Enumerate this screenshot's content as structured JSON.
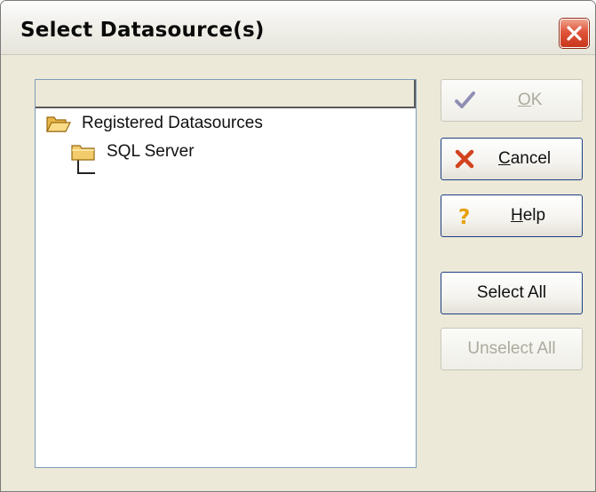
{
  "window": {
    "title": "Select Datasource(s)",
    "close_icon": "close-icon"
  },
  "tree": {
    "header": "",
    "nodes": [
      {
        "label": "Registered Datasources",
        "icon": "folder-open-icon",
        "level": 0
      },
      {
        "label": "SQL Server",
        "icon": "folder-icon",
        "level": 1
      }
    ]
  },
  "buttons": {
    "ok": {
      "mnemonic": "O",
      "rest": "K",
      "enabled": false,
      "icon": "checkmark-icon"
    },
    "cancel": {
      "mnemonic": "C",
      "rest": "ancel",
      "enabled": true,
      "icon": "red-x-icon"
    },
    "help": {
      "mnemonic": "H",
      "rest": "elp",
      "enabled": true,
      "icon": "question-mark-icon"
    },
    "select_all": {
      "label": "Select All",
      "enabled": true
    },
    "unselect_all": {
      "label": "Unselect All",
      "enabled": false
    }
  },
  "colors": {
    "window_bg": "#ece9d8",
    "close_button": "#e0543b",
    "button_border": "#1e3f86",
    "disabled_text": "#acaa9c"
  }
}
